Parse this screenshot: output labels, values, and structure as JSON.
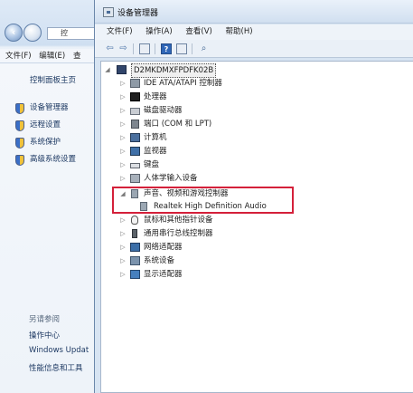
{
  "bg_window": {
    "address_text": "控",
    "menu": [
      "文件(F)",
      "编辑(E)",
      "查"
    ],
    "home": "控制面板主页",
    "links": [
      "设备管理器",
      "远程设置",
      "系统保护",
      "高级系统设置"
    ],
    "see_also": "另请参阅",
    "bottom_links": [
      "操作中心",
      "Windows Updat",
      "性能信息和工具"
    ]
  },
  "dm": {
    "title": "设备管理器",
    "menu": [
      "文件(F)",
      "操作(A)",
      "查看(V)",
      "帮助(H)"
    ],
    "root": "D2MKDMXFPDFK02B",
    "categories": [
      {
        "label": "IDE ATA/ATAPI 控制器",
        "icon": "ide-controller-icon"
      },
      {
        "label": "处理器",
        "icon": "processor-icon"
      },
      {
        "label": "磁盘驱动器",
        "icon": "disk-drive-icon"
      },
      {
        "label": "端口 (COM 和 LPT)",
        "icon": "port-icon"
      },
      {
        "label": "计算机",
        "icon": "computer-icon"
      },
      {
        "label": "监视器",
        "icon": "monitor-icon"
      },
      {
        "label": "键盘",
        "icon": "keyboard-icon"
      },
      {
        "label": "人体学输入设备",
        "icon": "hid-icon"
      },
      {
        "label": "声音、视频和游戏控制器",
        "icon": "sound-icon",
        "expanded": true
      },
      {
        "label": "Realtek High Definition Audio",
        "icon": "speaker-icon",
        "child": true
      },
      {
        "label": "鼠标和其他指针设备",
        "icon": "mouse-icon"
      },
      {
        "label": "通用串行总线控制器",
        "icon": "usb-icon"
      },
      {
        "label": "网络适配器",
        "icon": "network-adapter-icon"
      },
      {
        "label": "系统设备",
        "icon": "system-device-icon"
      },
      {
        "label": "显示适配器",
        "icon": "display-adapter-icon"
      }
    ]
  },
  "colors": {
    "highlight_box": "#d4203a",
    "window_frame": "#d7e4f2"
  }
}
